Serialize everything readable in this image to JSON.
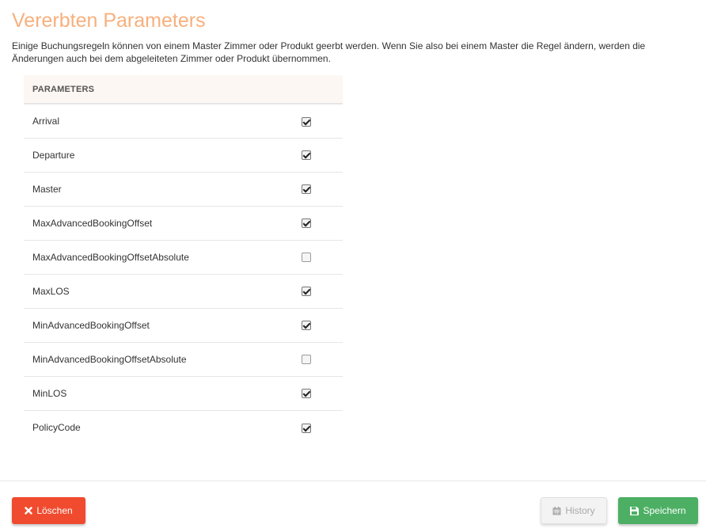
{
  "page": {
    "title": "Vererbten Parameters",
    "description": "Einige Buchungsregeln können von einem Master Zimmer oder Produkt geerbt werden. Wenn Sie also bei einem Master die Regel ändern, werden die Änderungen auch bei dem abgeleiteten Zimmer oder Produkt übernommen."
  },
  "table": {
    "header": "PARAMETERS",
    "rows": [
      {
        "name": "Arrival",
        "checked": true
      },
      {
        "name": "Departure",
        "checked": true
      },
      {
        "name": "Master",
        "checked": true
      },
      {
        "name": "MaxAdvancedBookingOffset",
        "checked": true
      },
      {
        "name": "MaxAdvancedBookingOffsetAbsolute",
        "checked": false
      },
      {
        "name": "MaxLOS",
        "checked": true
      },
      {
        "name": "MinAdvancedBookingOffset",
        "checked": true
      },
      {
        "name": "MinAdvancedBookingOffsetAbsolute",
        "checked": false
      },
      {
        "name": "MinLOS",
        "checked": true
      },
      {
        "name": "PolicyCode",
        "checked": true
      }
    ]
  },
  "footer": {
    "delete_label": "Löschen",
    "delete_icon": "times-icon",
    "history_label": "History",
    "history_icon": "calendar-icon",
    "save_label": "Speichern",
    "save_icon": "floppy-disk-icon"
  },
  "colors": {
    "title": "#f7b07d",
    "delete": "#f04b2f",
    "save": "#4caf64",
    "history_bg": "#f3f3f3"
  }
}
